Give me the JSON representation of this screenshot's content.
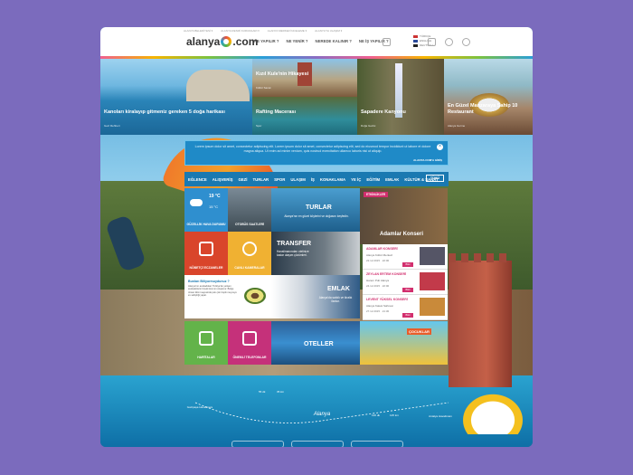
{
  "header": {
    "top_links": [
      "ALANYA BELEDİYESİ ▾",
      "ALANYA RESMİ KURUMLARI ▾",
      "ALANYA MERKEZ İNCELEME ▾",
      "ALANYA'YA ULAŞIM ▾"
    ],
    "logo_text_left": "alanya",
    "logo_text_right": ".com",
    "nav": [
      "NE YAPILIR ?",
      "NE YENİR ?",
      "NEREDE KALINIR ?",
      "NE İŞ YAPILIR ?"
    ],
    "languages": [
      "TÜRKÇE",
      "ENGLISH",
      "DEUTSCH"
    ]
  },
  "featured": [
    {
      "title": "Kanoları kiralayıp gitmeniz gereken 5 doğa harikası",
      "subtitle": "Gezi Rehberi"
    },
    {
      "title": "Kızıl Kule'nin Hikayesi",
      "subtitle": "Kültür Sanat"
    },
    {
      "title": "Rafting Macerası",
      "subtitle": "Spor"
    },
    {
      "title": "Sapadere Kanyonu",
      "subtitle": "Doğa Gezisi"
    },
    {
      "title": "En Güzel Manzaraya Sahip 10 Restaurant",
      "subtitle": "Alanya Gurme"
    }
  ],
  "notice": {
    "text": "Lorem ipsum dolor sit amet, consectetur adipiscing elit. Lorem ipsum dolor sit amet, consectetur adipiscing elit, sed do eiusmod tempor incididunt ut labore et dolore magna aliqua. Ut enim ad minim veniam, quis nostrud exercitation ullamco laboris nisi ut aliquip.",
    "link": "ALANYA.COM'A GİRİŞ"
  },
  "categories": [
    "EĞLENCE",
    "ALIŞVERİŞ",
    "GEZİ",
    "TURLAR",
    "SPOR",
    "ULAŞIM",
    "İŞ",
    "KONAKLAMA",
    "YE İÇ",
    "EĞİTİM",
    "EMLAK",
    "KÜLTÜR & SANAT"
  ],
  "all_label": "TÜMÜ",
  "weather": {
    "temp_day": "19 °C",
    "temp_night": "15 °C",
    "label": "GÜZELLİK HAVA DURUMU"
  },
  "tiles": {
    "otobus": "OTOBÜS SAATLERİ",
    "turlar": "TURLAR",
    "turlar_sub": "Alanya'nın en güzel köylerini ve doğasını keşfedin.",
    "nobetci": "NÖBETÇİ ECZANELER",
    "canli": "CANLI KAMERALAR",
    "transfer": "TRANSFER",
    "transfer_sub": "Havalimanından otelinize kadar ulaşım çözümleri.",
    "emlak": "EMLAK",
    "emlak_sub": "Alanya'da satılık ve kiralık ilanlar.",
    "haritalar": "HARİTALAR",
    "onemli": "ÖNEMLİ TELEFONLAR",
    "oteller": "OTELLER",
    "kids": "ÇOCUKLAR"
  },
  "know": {
    "title": "Bunları Biliyormuydunuz ?",
    "text": "Alanya'nın avokadoları Türkiye'de yetişen avokadoların büyük kısmını oluşturur. Bölge ılıman iklimi sayesinde pek çok tropik meyveye ev sahipliği yapar."
  },
  "events": {
    "badge": "ETKİNLİKLER",
    "featured_name": "Adamlar Konseri",
    "list": [
      {
        "title": "ADAMLAR KONSERİ",
        "venue": "Alanya Kültür Merkezi",
        "date": "22.12.2015",
        "time": "22:00",
        "btn": "Bilet"
      },
      {
        "title": "ZEYLAN ERTEM KONSERİ",
        "venue": "Harem Pub Alanya",
        "date": "24.12.2015",
        "time": "22:00",
        "btn": "Bilet"
      },
      {
        "title": "LEVENT YÜKSEL KONSERİ",
        "venue": "Alanya Kalesi Sahnesi",
        "date": "27.12.2015",
        "time": "21:30",
        "btn": "Bilet"
      }
    ]
  },
  "route": {
    "label": "Alanya",
    "start": "Gazipaşa Havalimanı",
    "end": "Antalya Havalimanı",
    "t1": "55 dk",
    "t2": "35 km",
    "t3": "120 dk",
    "t4": "125 km"
  },
  "colors": {
    "accent": "#1a79b1",
    "pink": "#d22f6e",
    "weather": "#2f8fcf",
    "red": "#d9452b",
    "yellow": "#f0b132",
    "green": "#63b34a",
    "magenta": "#c5317a"
  }
}
